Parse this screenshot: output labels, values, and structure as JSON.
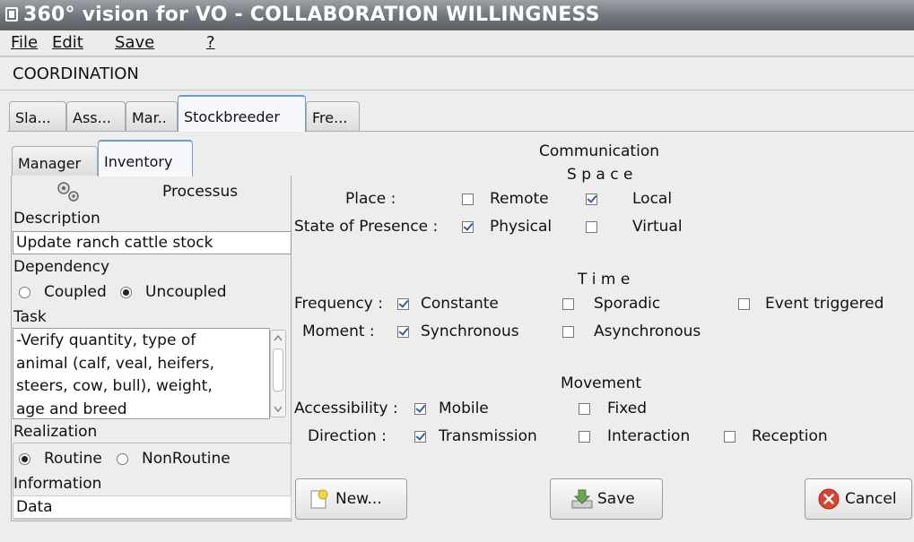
{
  "window": {
    "title": "360° vision for VO - COLLABORATION WILLINGNESS"
  },
  "menu": {
    "file": "File",
    "edit": "Edit",
    "save": "Save",
    "help": "?"
  },
  "section_label": "COORDINATION",
  "tabs": [
    {
      "label": "Sla...",
      "active": false
    },
    {
      "label": "Ass...",
      "active": false
    },
    {
      "label": "Mar..",
      "active": false
    },
    {
      "label": "Stockbreeder",
      "active": true
    },
    {
      "label": "Fre...",
      "active": false
    }
  ],
  "subtabs": [
    {
      "label": "Manager",
      "active": false
    },
    {
      "label": "Inventory",
      "active": true
    }
  ],
  "left": {
    "process_title": "Processus",
    "process_icon": "gears-icon",
    "description_label": "Description",
    "description_value": "Update ranch cattle stock",
    "dependency_label": "Dependency",
    "dependency_options": [
      "Coupled",
      "Uncoupled"
    ],
    "dependency_selected": "Uncoupled",
    "task_label": "Task",
    "task_lines": [
      "-Verify quantity, type of",
      "animal (calf, veal, heifers,",
      "steers, cow, bull), weight,",
      "age and breed"
    ],
    "realization_label": "Realization",
    "realization_options": [
      "Routine",
      "NonRoutine"
    ],
    "realization_selected": "Routine",
    "information_label": "Information",
    "information_value": "Data"
  },
  "communication": {
    "title": "Communication",
    "space": {
      "heading": "S p a c e",
      "place_label": "Place :",
      "place_options": [
        {
          "label": "Remote",
          "checked": false
        },
        {
          "label": "Local",
          "checked": true
        }
      ],
      "presence_label": "State of Presence :",
      "presence_options": [
        {
          "label": "Physical",
          "checked": true
        },
        {
          "label": "Virtual",
          "checked": false
        }
      ]
    },
    "time": {
      "heading": "T i m e",
      "frequency_label": "Frequency :",
      "frequency_options": [
        {
          "label": "Constante",
          "checked": true
        },
        {
          "label": "Sporadic",
          "checked": false
        },
        {
          "label": "Event triggered",
          "checked": false
        }
      ],
      "moment_label": "Moment :",
      "moment_options": [
        {
          "label": "Synchronous",
          "checked": true
        },
        {
          "label": "Asynchronous",
          "checked": false
        }
      ]
    },
    "movement": {
      "heading": "Movement",
      "accessibility_label": "Accessibility :",
      "accessibility_options": [
        {
          "label": "Mobile",
          "checked": true
        },
        {
          "label": "Fixed",
          "checked": false
        }
      ],
      "direction_label": "Direction :",
      "direction_options": [
        {
          "label": "Transmission",
          "checked": true
        },
        {
          "label": "Interaction",
          "checked": false
        },
        {
          "label": "Reception",
          "checked": false
        }
      ]
    }
  },
  "buttons": {
    "new": "New...",
    "save": "Save",
    "cancel": "Cancel"
  },
  "colors": {
    "accent": "#6c9ad3",
    "titlebar": "#6f757b",
    "cancel_red": "#d9432f",
    "save_green": "#6aa84f"
  }
}
